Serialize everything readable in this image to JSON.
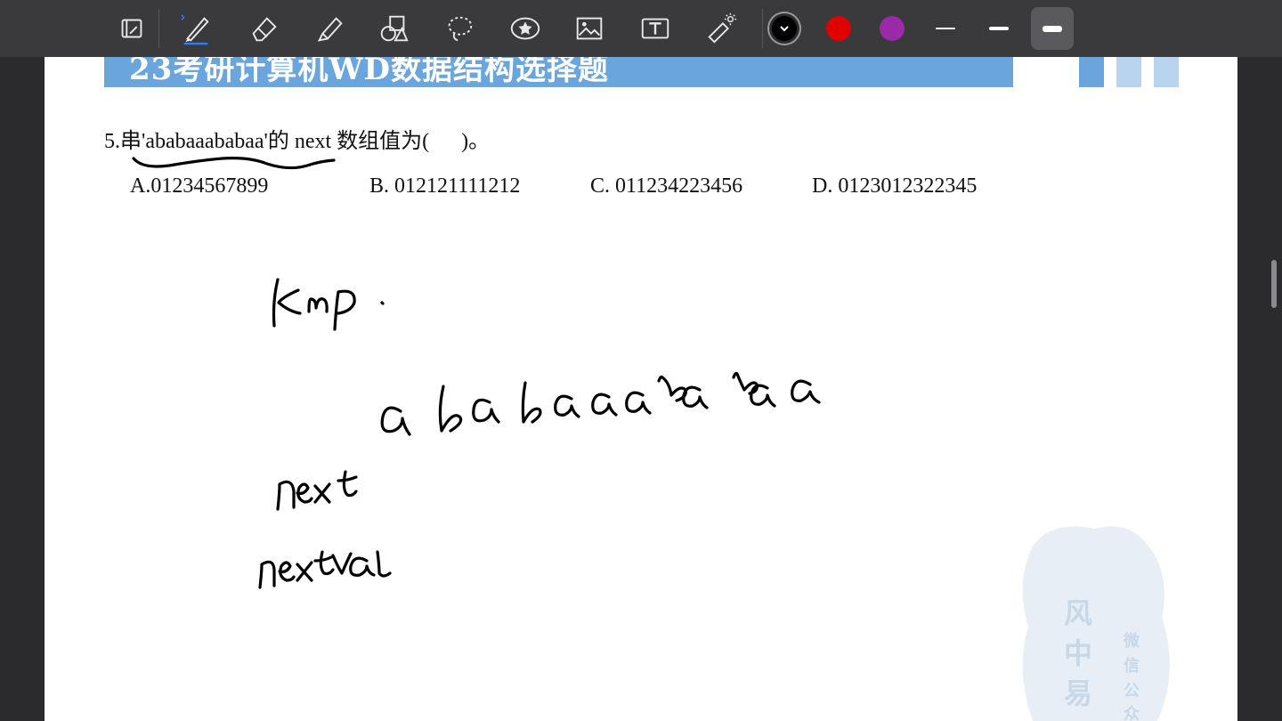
{
  "toolbar": {
    "tools": [
      {
        "name": "read-mode-icon"
      },
      {
        "name": "pen-icon"
      },
      {
        "name": "eraser-icon"
      },
      {
        "name": "highlighter-icon"
      },
      {
        "name": "shapes-icon"
      },
      {
        "name": "lasso-icon"
      },
      {
        "name": "sticker-icon"
      },
      {
        "name": "image-icon"
      },
      {
        "name": "text-icon"
      },
      {
        "name": "laser-pointer-icon"
      }
    ],
    "colors": [
      "#000000",
      "#e00000",
      "#9b2aa8"
    ],
    "selected_color": "#000000"
  },
  "document": {
    "banner_title": "23考研计算机WD数据结构选择题",
    "question": "5.串'ababaaababaa'的 next 数组值为(      )。",
    "options": {
      "a": "A.01234567899",
      "b": "B. 012121111212",
      "c": "C. 011234223456",
      "d": "D. 0123012322345"
    }
  },
  "handwriting": {
    "kmp": "kmp",
    "string": "ababaaababaa",
    "next": "next",
    "nextval": "nextval"
  },
  "watermark": {
    "chars": [
      "风",
      "中",
      "易"
    ],
    "side": [
      "微",
      "信",
      "公",
      "众"
    ]
  }
}
